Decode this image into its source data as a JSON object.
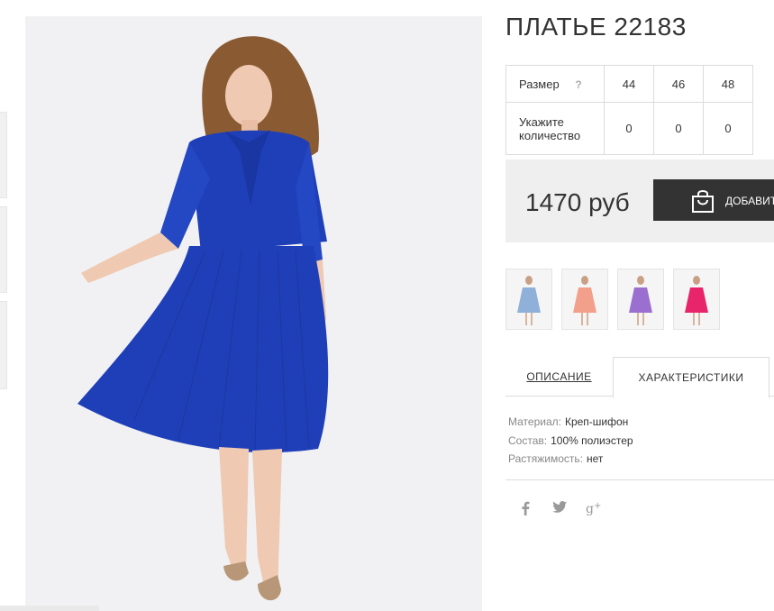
{
  "product": {
    "title": "ПЛАТЬЕ 22183",
    "price": "1470 руб",
    "add_to_cart_label": "ДОБАВИТЬ"
  },
  "size_table": {
    "size_label": "Размер",
    "help": "?",
    "sizes": [
      "44",
      "46",
      "48"
    ],
    "quantity_label": "Укажите количество",
    "quantities": [
      "0",
      "0",
      "0"
    ]
  },
  "variants": [
    {
      "color_name": "light-blue",
      "color": "#8fb0d9"
    },
    {
      "color_name": "peach",
      "color": "#f2a08c"
    },
    {
      "color_name": "violet",
      "color": "#9a6fd0"
    },
    {
      "color_name": "pink",
      "color": "#e8246a"
    }
  ],
  "tabs": {
    "description": "ОПИСАНИЕ",
    "characteristics": "ХАРАКТЕРИСТИКИ"
  },
  "specs": [
    {
      "key": "Материал:",
      "value": "Креп-шифон"
    },
    {
      "key": "Состав:",
      "value": "100% полиэстер"
    },
    {
      "key": "Растяжимость:",
      "value": "нет"
    }
  ],
  "social": [
    "facebook-icon",
    "twitter-icon",
    "google-plus-icon"
  ],
  "colors": {
    "dress": "#1f3fb8",
    "accent_dark": "#333333"
  }
}
